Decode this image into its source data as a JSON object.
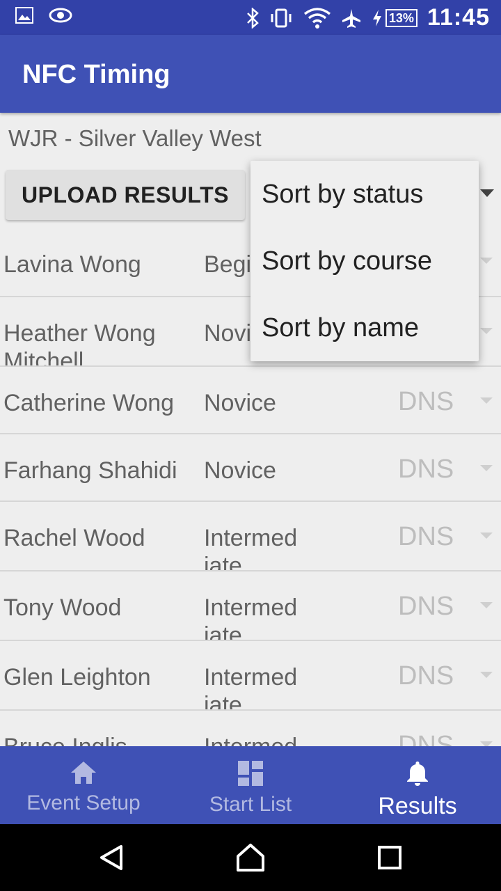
{
  "status_bar": {
    "battery_percent": "13%",
    "time": "11:45",
    "icons": [
      "image-icon",
      "eye-icon",
      "bluetooth-icon",
      "vibrate-icon",
      "wifi-icon",
      "airplane-icon",
      "charging-icon"
    ]
  },
  "app_bar": {
    "title": "NFC Timing"
  },
  "event": {
    "name": "WJR - Silver Valley West"
  },
  "actions": {
    "upload_label": "UPLOAD RESULTS"
  },
  "sort_menu": {
    "items": [
      {
        "label": "Sort by status"
      },
      {
        "label": "Sort by course"
      },
      {
        "label": "Sort by name"
      }
    ]
  },
  "results": [
    {
      "name": "Lavina Wong",
      "course": "Beginner",
      "status": ""
    },
    {
      "name": "Heather Wong Mitchell",
      "course": "Novice",
      "status": ""
    },
    {
      "name": "Catherine Wong",
      "course": "Novice",
      "status": "DNS"
    },
    {
      "name": "Farhang Shahidi",
      "course": "Novice",
      "status": "DNS"
    },
    {
      "name": "Rachel Wood",
      "course": "Intermediate",
      "status": "DNS"
    },
    {
      "name": "Tony Wood",
      "course": "Intermediate",
      "status": "DNS"
    },
    {
      "name": "Glen Leighton",
      "course": "Intermediate",
      "status": "DNS"
    },
    {
      "name": "Bruce Inglis",
      "course": "Intermediate",
      "status": "DNS"
    }
  ],
  "bottom_nav": {
    "items": [
      {
        "label": "Event Setup",
        "icon": "home-icon"
      },
      {
        "label": "Start List",
        "icon": "dashboard-icon"
      },
      {
        "label": "Results",
        "icon": "bell-icon"
      }
    ],
    "active_index": 2
  },
  "colors": {
    "primary": "#3f51b5",
    "primary_dark": "#3241a8",
    "background": "#eeeeee"
  }
}
